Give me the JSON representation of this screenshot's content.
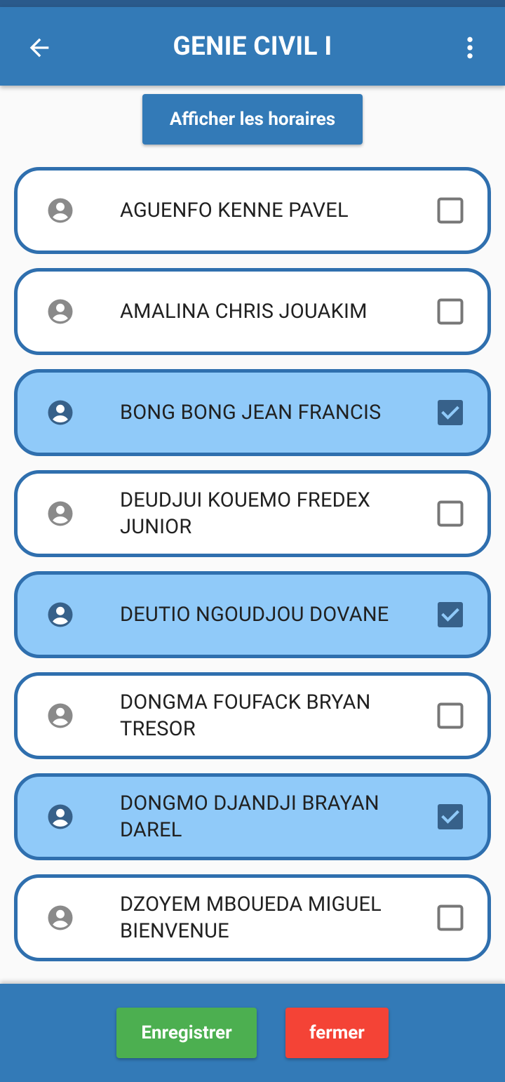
{
  "app_bar": {
    "title": "GENIE CIVIL I",
    "back_icon": "arrow-back-icon",
    "menu_icon": "more-vert-icon"
  },
  "actions": {
    "show_hours_label": "Afficher les horaires"
  },
  "students": [
    {
      "name": "AGUENFO KENNE PAVEL",
      "checked": false
    },
    {
      "name": "AMALINA CHRIS JOUAKIM",
      "checked": false
    },
    {
      "name": "BONG BONG JEAN FRANCIS",
      "checked": true
    },
    {
      "name": "DEUDJUI KOUEMO FREDEX JUNIOR",
      "checked": false
    },
    {
      "name": "DEUTIO NGOUDJOU DOVANE",
      "checked": true
    },
    {
      "name": "DONGMA FOUFACK BRYAN TRESOR",
      "checked": false
    },
    {
      "name": "DONGMO DJANDJI BRAYAN DAREL",
      "checked": true
    },
    {
      "name": "DZOYEM MBOUEDA MIGUEL BIENVENUE",
      "checked": false
    }
  ],
  "footer": {
    "save_label": "Enregistrer",
    "close_label": "fermer"
  },
  "colors": {
    "primary": "#337ab7",
    "selected_bg": "#90caf9",
    "card_border": "#2f6fae",
    "save": "#4caf50",
    "close": "#f44336"
  }
}
